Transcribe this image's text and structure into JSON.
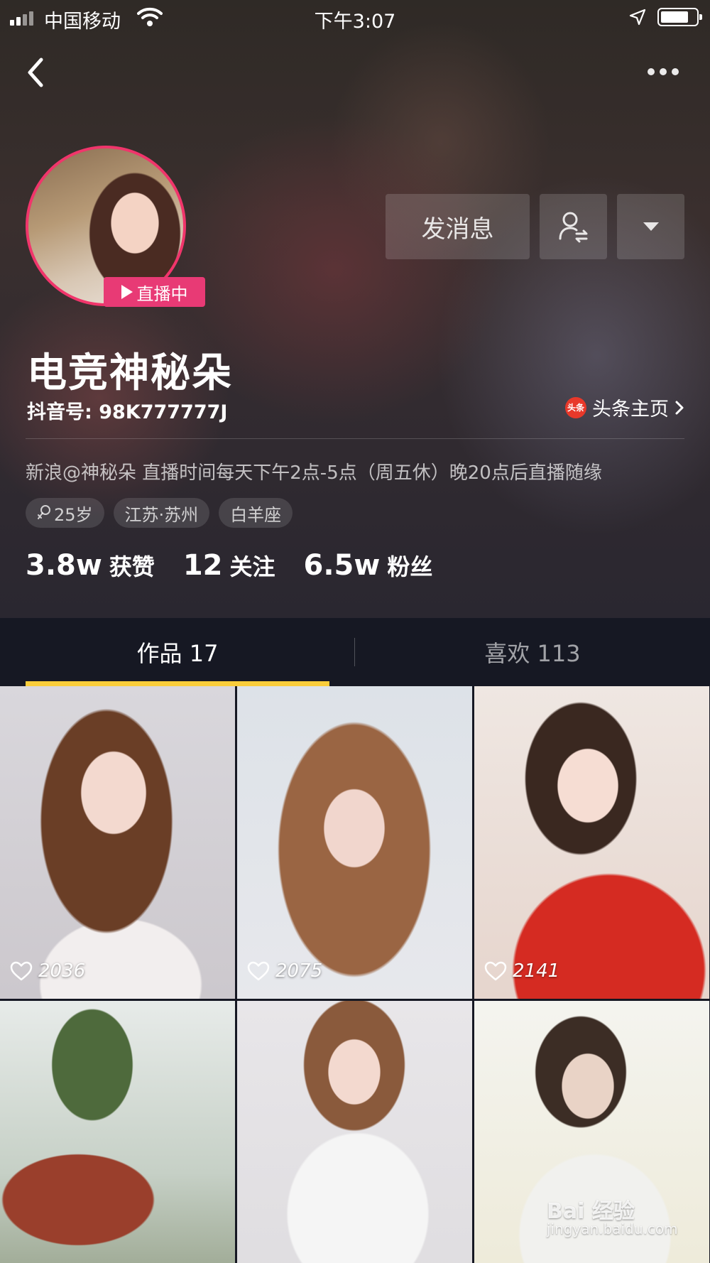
{
  "status_bar": {
    "carrier": "中国移动",
    "time": "下午3:07"
  },
  "profile": {
    "live_badge": "直播中",
    "message_button": "发消息",
    "nickname": "电竞神秘朵",
    "douyin_id": "抖音号: 98K777777J",
    "toutiao_link": "头条主页",
    "toutiao_icon_text": "头条",
    "bio": "新浪@神秘朵 直播时间每天下午2点-5点（周五休）晚20点后直播随缘",
    "tags": {
      "age": "25岁",
      "location": "江苏·苏州",
      "zodiac": "白羊座"
    },
    "stats": {
      "likes_num": "3.8w",
      "likes_label": "获赞",
      "following_num": "12",
      "following_label": "关注",
      "fans_num": "6.5w",
      "fans_label": "粉丝"
    }
  },
  "tabs": {
    "works": "作品 17",
    "likes": "喜欢 113"
  },
  "videos": [
    {
      "likes": "2036"
    },
    {
      "likes": "2075"
    },
    {
      "likes": "2141"
    }
  ],
  "watermark": {
    "brand": "Bai 经验",
    "url": "jingyan.baidu.com"
  },
  "colors": {
    "accent_tab": "#facd3a",
    "live_badge": "#e83a75",
    "avatar_ring": "#f0356b",
    "background": "#161823"
  }
}
